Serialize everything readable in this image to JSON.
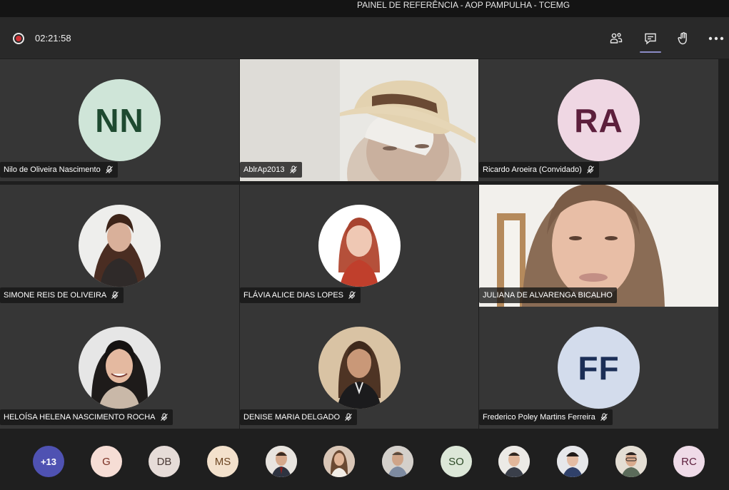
{
  "window": {
    "title": "PAINEL DE REFERÊNCIA - AOP PAMPULHA - TCEMG"
  },
  "toolbar": {
    "timer": "02:21:58",
    "icons": [
      "participants-icon",
      "chat-icon",
      "raise-hand-icon",
      "more-options-icon"
    ]
  },
  "tiles": [
    {
      "name": "Nilo de Oliveira Nascimento",
      "initials": "NN",
      "avatar_bg": "#cfe5d8",
      "avatar_fg": "#1e4a30",
      "kind": "initials"
    },
    {
      "name": "AblrAp2013",
      "kind": "video"
    },
    {
      "name": "Ricardo Aroeira (Convidado)",
      "initials": "RA",
      "avatar_bg": "#efd7e3",
      "avatar_fg": "#5c1f3c",
      "kind": "initials"
    },
    {
      "name": "SIMONE REIS DE OLIVEIRA",
      "kind": "photo"
    },
    {
      "name": "FLÁVIA ALICE DIAS LOPES",
      "kind": "photo"
    },
    {
      "name": "JULIANA DE ALVARENGA BICALHO",
      "kind": "video"
    },
    {
      "name": "HELOÍSA HELENA NASCIMENTO ROCHA",
      "kind": "photo"
    },
    {
      "name": "DENISE MARIA DELGADO",
      "kind": "photo"
    },
    {
      "name": "Frederico Poley Martins Ferreira",
      "initials": "FF",
      "avatar_bg": "#d3dcec",
      "avatar_fg": "#1b2e56",
      "kind": "initials"
    }
  ],
  "strip": {
    "overflow_label": "+13",
    "avatars": [
      {
        "initials": "G",
        "bg": "#f6ddd5"
      },
      {
        "initials": "DB",
        "bg": "#e6dcd8"
      },
      {
        "initials": "MS",
        "bg": "#f3e1cc"
      },
      {
        "initials": "",
        "bg": "#cfc7bf"
      },
      {
        "initials": "",
        "bg": "#d8c4b4"
      },
      {
        "initials": "",
        "bg": "#c8c2bb"
      },
      {
        "initials": "SO",
        "bg": "#dce7d8"
      },
      {
        "initials": "",
        "bg": "#cfd3d6"
      },
      {
        "initials": "",
        "bg": "#c9ccd1"
      },
      {
        "initials": "",
        "bg": "#cdc6bc"
      },
      {
        "initials": "RC",
        "bg": "#efdbe8"
      }
    ]
  }
}
